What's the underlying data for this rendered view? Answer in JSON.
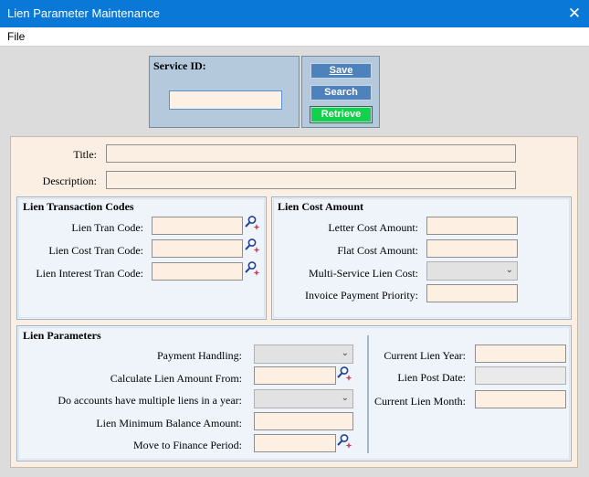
{
  "window": {
    "title": "Lien Parameter Maintenance",
    "close_glyph": "✕"
  },
  "menu": {
    "file_label": "File"
  },
  "service": {
    "label": "Service ID:",
    "value": "",
    "save_label": "Save",
    "search_label": "Search",
    "retrieve_label": "Retrieve"
  },
  "general": {
    "title_label": "Title:",
    "title_value": "",
    "description_label": "Description:",
    "description_value": ""
  },
  "tran_codes": {
    "heading": "Lien Transaction Codes",
    "lien_tran_label": "Lien Tran Code:",
    "lien_cost_tran_label": "Lien Cost Tran Code:",
    "lien_interest_tran_label": "Lien Interest Tran Code:"
  },
  "cost_amount": {
    "heading": "Lien Cost Amount",
    "letter_cost_label": "Letter Cost Amount:",
    "flat_cost_label": "Flat Cost Amount:",
    "multi_service_label": "Multi-Service Lien Cost:",
    "invoice_priority_label": "Invoice Payment Priority:"
  },
  "parameters": {
    "heading": "Lien Parameters",
    "payment_handling_label": "Payment Handling:",
    "calc_amount_label": "Calculate Lien Amount From:",
    "multiple_liens_label": "Do accounts have multiple liens in a year:",
    "min_balance_label": "Lien Minimum Balance Amount:",
    "finance_period_label": "Move to Finance Period:",
    "current_year_label": "Current Lien Year:",
    "post_date_label": "Lien Post Date:",
    "current_month_label": "Current Lien Month:"
  },
  "icons": {
    "lookup": "magnifier-sparkle-icon",
    "dropdown": "chevron-down-icon",
    "chevron_glyph": "⌄"
  },
  "colors": {
    "titlebar": "#0a78d7",
    "button_blue": "#4e82bd",
    "button_green": "#13d14d",
    "panel_peach": "#fbefe4",
    "group_bg": "#eef4fa"
  }
}
